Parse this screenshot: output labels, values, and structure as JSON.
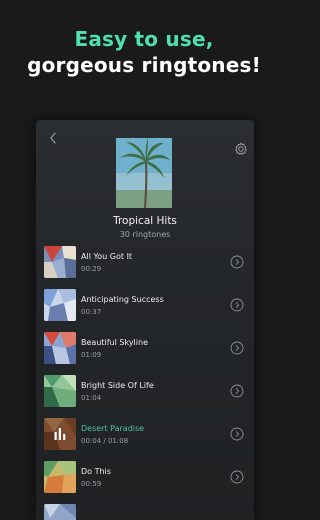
{
  "headline": {
    "line1": "Easy to use,",
    "line2": "gorgeous ringtones!"
  },
  "album": {
    "title": "Tropical Hits",
    "count": "30 ringtones"
  },
  "colors": {
    "accent": "#4fe0b0",
    "active_track": "#4ac7a0",
    "background": "#1a1a1a"
  },
  "tracks": [
    {
      "title": "All You Got It",
      "duration": "00:29",
      "active": false,
      "thumb": [
        "#c9443f",
        "#7a8fb8",
        "#e8e0d0"
      ]
    },
    {
      "title": "Anticipating Success",
      "duration": "00:37",
      "active": false,
      "thumb": [
        "#7ea0d8",
        "#cbd6ea",
        "#6a7fb0"
      ]
    },
    {
      "title": "Beautiful Skyline",
      "duration": "01:09",
      "active": false,
      "thumb": [
        "#d64a3c",
        "#8aa5d0",
        "#3c4f86"
      ]
    },
    {
      "title": "Bright Side Of Life",
      "duration": "01:04",
      "active": false,
      "thumb": [
        "#4f9c6a",
        "#93c79a",
        "#2f6b48"
      ]
    },
    {
      "title": "Desert Paradise",
      "duration": "00:04 / 01:08",
      "active": true,
      "thumb": [
        "#a8643e",
        "#c58a5c",
        "#7a4426"
      ]
    },
    {
      "title": "Do This",
      "duration": "00:59",
      "active": false,
      "thumb": [
        "#5e9e62",
        "#c7b86a",
        "#d67c3a"
      ]
    }
  ]
}
